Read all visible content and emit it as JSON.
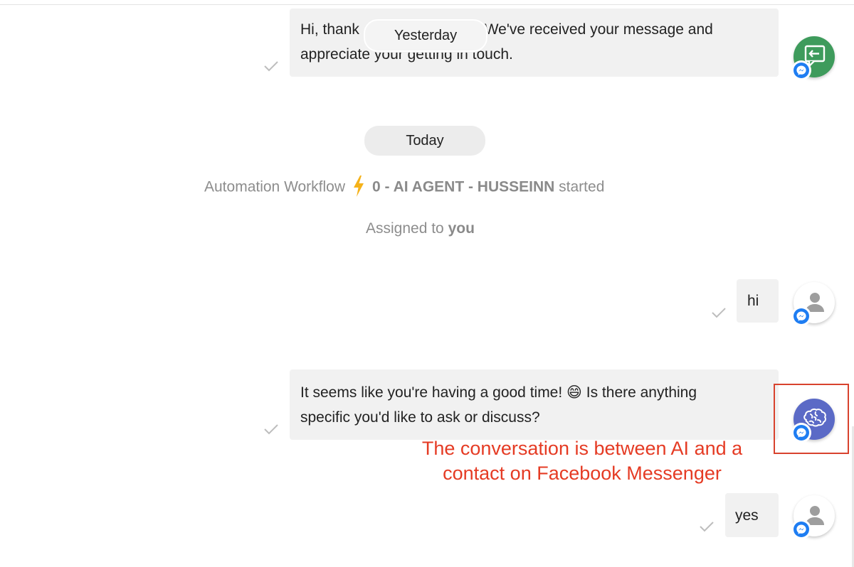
{
  "conversation": {
    "first_message": {
      "text_start": "Hi, thank",
      "text_end": "us. We've received your message and",
      "text_line2": "appreciate your getting in touch."
    },
    "date_dividers": {
      "yesterday": "Yesterday",
      "today": "Today"
    },
    "system_events": {
      "workflow_prefix": "Automation Workflow",
      "workflow_name": "0 - AI AGENT - HUSSEINN",
      "workflow_suffix": "started",
      "assigned_prefix": "Assigned to",
      "assigned_target": "you"
    },
    "contact_message_1": {
      "text": "hi"
    },
    "ai_message": {
      "line1": "It seems like you're having a good time! 😄 Is there anything",
      "line2": "specific you'd like to ask or discuss?"
    },
    "contact_message_2": {
      "text": "yes"
    }
  },
  "annotation": {
    "line1": "The conversation is between AI and a",
    "line2": "contact on Facebook Messenger"
  },
  "icons": {
    "delivered": "check-icon",
    "workflow": "lightning-bolt-icon",
    "channel": "facebook-messenger-icon",
    "ai_agent": "brain-icon",
    "contact": "person-icon",
    "auto_reply": "message-reply-icon"
  },
  "colors": {
    "bubble": "#f1f1f1",
    "messenger_blue": "#1e7df2",
    "bot_green": "#3e9b5c",
    "ai_purple": "#5b6ac6",
    "bolt_amber": "#f5b21a",
    "annotation_red": "#e53b24"
  }
}
